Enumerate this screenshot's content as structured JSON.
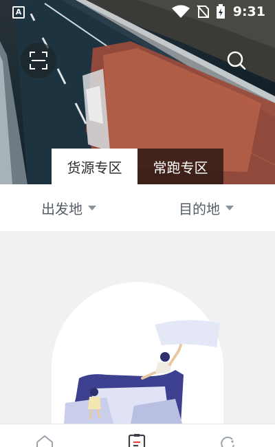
{
  "status_bar": {
    "left_icon": "A",
    "time": "9:31",
    "icons": [
      "wifi-icon",
      "no-sim-icon",
      "battery-charging-icon"
    ]
  },
  "header": {
    "scan_icon": "scan-icon",
    "search_icon": "search-icon",
    "tabs": [
      {
        "label": "货源专区",
        "active": true
      },
      {
        "label": "常跑专区",
        "active": false
      }
    ]
  },
  "filters": {
    "origin_label": "出发地",
    "destination_label": "目的地"
  },
  "bottom_nav": {
    "items": [
      "home-icon",
      "orders-icon",
      "profile-icon"
    ]
  },
  "colors": {
    "active_tab_bg": "#ffffff",
    "inactive_tab_bg": "#3a1f18",
    "filter_text": "#555c66",
    "content_bg": "#f1f1f1",
    "illustration_primary": "#3d3f8f",
    "illustration_light": "#dfe3f5"
  }
}
